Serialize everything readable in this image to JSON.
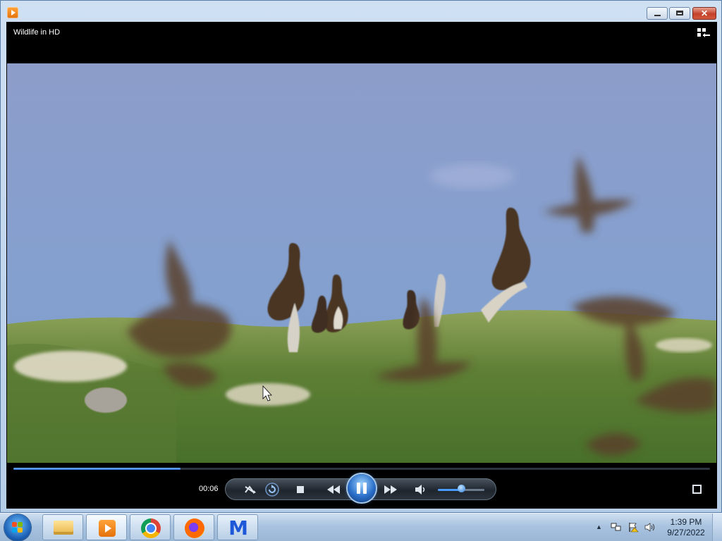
{
  "window": {
    "controls": {
      "minimize": "minimize",
      "maximize": "maximize",
      "close": "✕"
    }
  },
  "player": {
    "title": "Wildlife in HD",
    "elapsed": "00:06",
    "progress_fraction": 0.24,
    "volume_fraction": 0.5,
    "controls": [
      "shuffle-icon",
      "repeat-icon",
      "stop-icon",
      "previous-icon",
      "pause-icon",
      "next-icon",
      "speaker-icon"
    ]
  },
  "taskbar": {
    "apps": [
      "windows-explorer",
      "windows-media-player",
      "google-chrome",
      "firefox",
      "malwarebytes"
    ],
    "clock": {
      "time": "1:39 PM",
      "date": "9/27/2022"
    }
  },
  "colors": {
    "accent": "#2f70d8",
    "taskbar": "#a9c3df"
  }
}
